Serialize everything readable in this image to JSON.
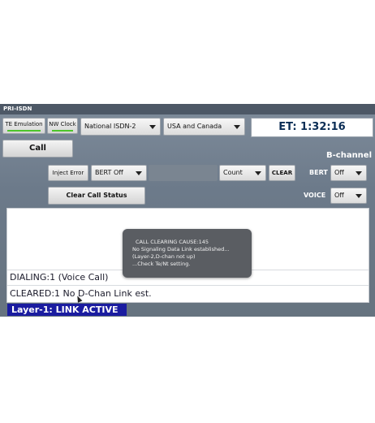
{
  "window": {
    "title": "PRI-ISDN"
  },
  "toolbar": {
    "te_emulation": "TE Emulation",
    "nw_clock": "NW Clock",
    "protocol": "National ISDN-2",
    "region": "USA and Canada",
    "elapsed_time": "ET: 1:32:16"
  },
  "call": {
    "call_button": "Call",
    "inject_error": "Inject Error",
    "bert_select": "BERT Off",
    "count_select": "Count",
    "clear_button": "CLEAR",
    "clear_call_status": "Clear Call Status"
  },
  "b_channel": {
    "title": "B-channel",
    "bert_label": "BERT",
    "bert_value": "Off",
    "voice_label": "VOICE",
    "voice_value": "Off"
  },
  "log": {
    "lines": [
      "DIALING:1 (Voice Call)",
      "CLEARED:1  No D-Chan Link est."
    ]
  },
  "toast": {
    "lines": [
      "CALL CLEARING CAUSE:145",
      "No Signaling Data Link established...",
      "(Layer-2,D-chan not up)",
      "...Check Te/Nt setting."
    ]
  },
  "status": {
    "layer1": "Layer-1: LINK ACTIVE"
  },
  "colors": {
    "app_background": "#6c7a8a",
    "toggle_indicator": "#4dc52b",
    "status_bar": "#1a1ca0",
    "timer_text": "#0b2d55"
  }
}
